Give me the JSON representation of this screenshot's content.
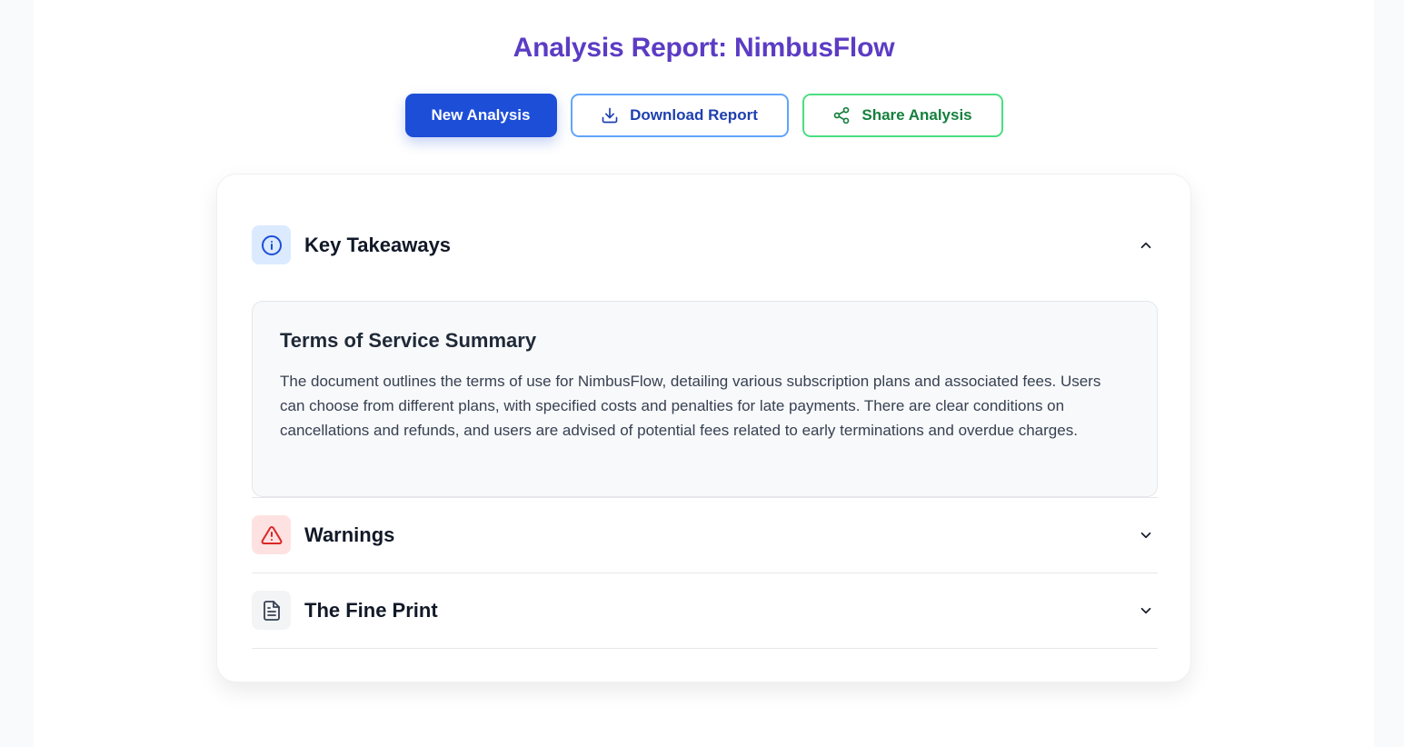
{
  "header": {
    "title": "Analysis Report: NimbusFlow"
  },
  "actions": {
    "new_analysis": "New Analysis",
    "download_report": "Download Report",
    "share_analysis": "Share Analysis"
  },
  "sections": {
    "key_takeaways": {
      "title": "Key Takeaways",
      "expanded": true,
      "summary_title": "Terms of Service Summary",
      "summary_text": "The document outlines the terms of use for NimbusFlow, detailing various subscription plans and associated fees. Users can choose from different plans, with specified costs and penalties for late payments. There are clear conditions on cancellations and refunds, and users are advised of potential fees related to early terminations and overdue charges."
    },
    "warnings": {
      "title": "Warnings",
      "expanded": false
    },
    "fine_print": {
      "title": "The Fine Print",
      "expanded": false
    }
  },
  "icons": {
    "key_takeaways": "info-icon",
    "warnings": "warning-triangle-icon",
    "fine_print": "document-icon",
    "download": "download-icon",
    "share": "share-icon"
  },
  "colors": {
    "title": "#5b3cc4",
    "primary": "#1d4ed8",
    "download_border": "#60a5fa",
    "share_border": "#4ade80",
    "warning": "#dc2626"
  }
}
